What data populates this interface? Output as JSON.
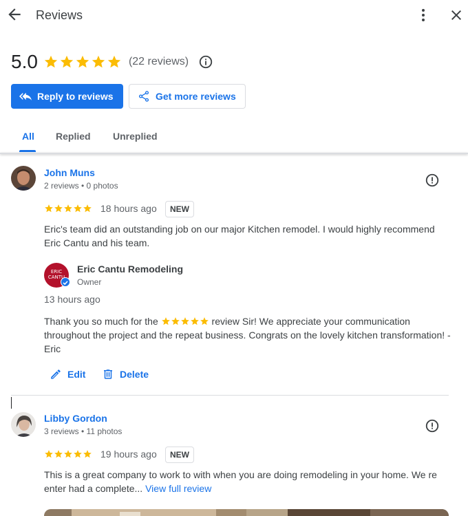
{
  "header": {
    "title": "Reviews"
  },
  "summary": {
    "rating": "5.0",
    "review_count": "(22 reviews)"
  },
  "buttons": {
    "reply": "Reply to reviews",
    "get_more": "Get more reviews"
  },
  "tabs": [
    {
      "label": "All",
      "active": true
    },
    {
      "label": "Replied",
      "active": false
    },
    {
      "label": "Unreplied",
      "active": false
    }
  ],
  "reviews": [
    {
      "name": "John Muns",
      "meta": "2 reviews • 0 photos",
      "stars": 5,
      "time": "18 hours ago",
      "badge": "NEW",
      "text": "Eric's team did an outstanding job on our major Kitchen remodel. I would highly recommend Eric Cantu and his team.",
      "reply": {
        "owner_name": "Eric Cantu Remodeling",
        "owner_role": "Owner",
        "logo_text": "ERIC CANTU",
        "time": "13 hours ago",
        "text_before": "Thank you so much for the ",
        "text_after": " review Sir! We appreciate your communication throughout the project and the repeat business. Congrats on the lovely kitchen transformation! - Eric",
        "inline_stars": 5
      },
      "actions": {
        "edit": "Edit",
        "delete": "Delete"
      }
    },
    {
      "name": "Libby Gordon",
      "meta": "3 reviews • 11 photos",
      "stars": 5,
      "time": "19 hours ago",
      "badge": "NEW",
      "text": "This is a great company to work to with when you are doing remodeling in your home. We re enter had a complete...",
      "view_full": "View full review"
    }
  ],
  "colors": {
    "accent": "#1a73e8",
    "star": "#fbbc04",
    "text": "#202124",
    "secondary": "#5f6368"
  }
}
